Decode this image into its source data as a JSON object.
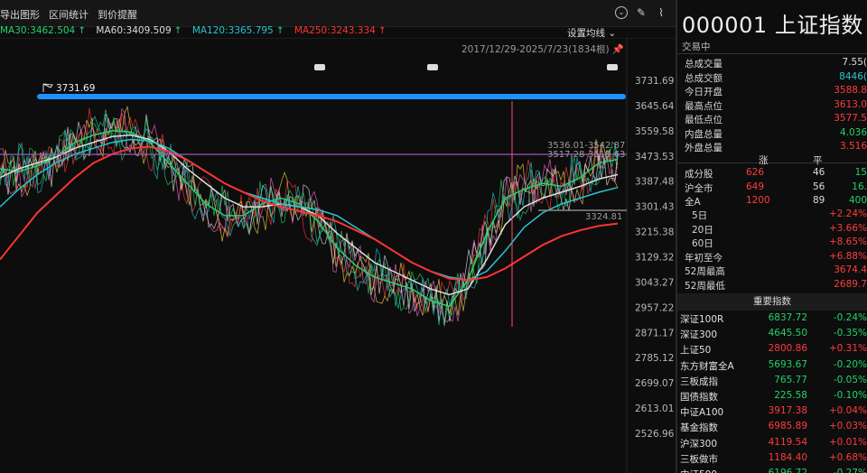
{
  "toolbar": {
    "export_label": "导出图形",
    "interval_label": "区间统计",
    "alert_label": "到价提醒"
  },
  "ma": [
    {
      "label": "MA30:3462.504",
      "color": "#27d36c"
    },
    {
      "label": "MA60:3409.509",
      "color": "#dddddd"
    },
    {
      "label": "MA120:3365.795",
      "color": "#26c6d0"
    },
    {
      "label": "MA250:3243.334",
      "color": "#ff3333"
    }
  ],
  "chart": {
    "settings_label": "设置均线",
    "range_label": "2017/12/29-2025/7/23(1834根)",
    "peak_label": "3731.69",
    "right_label_1": "3536.01-3542.87",
    "right_label_2": "3517.28-3518.63",
    "right_label_3": "3324.81",
    "y_ticks": [
      "3731.69",
      "3645.64",
      "3559.58",
      "3473.53",
      "3387.48",
      "3301.43",
      "3215.38",
      "3129.32",
      "3043.27",
      "2957.22",
      "2871.17",
      "2785.12",
      "2699.07",
      "2613.01",
      "2526.96"
    ],
    "ylim": [
      2526.96,
      3731.69
    ]
  },
  "chart_data": {
    "type": "line",
    "title": "",
    "xlabel": "",
    "ylabel": "",
    "ylim": [
      2526.96,
      3731.69
    ],
    "series": [
      {
        "name": "MA30",
        "color": "#27d36c",
        "values": [
          3430,
          3420,
          3440,
          3470,
          3520,
          3545,
          3560,
          3555,
          3520,
          3450,
          3380,
          3310,
          3270,
          3270,
          3310,
          3330,
          3310,
          3250,
          3160,
          3100,
          3060,
          3040,
          3020,
          2980,
          2960,
          3050,
          3210,
          3330,
          3360,
          3380,
          3370,
          3400,
          3450,
          3462
        ]
      },
      {
        "name": "MA60",
        "color": "#dddddd",
        "values": [
          3400,
          3430,
          3450,
          3470,
          3500,
          3520,
          3540,
          3545,
          3530,
          3490,
          3430,
          3380,
          3330,
          3300,
          3300,
          3310,
          3300,
          3270,
          3210,
          3160,
          3110,
          3080,
          3050,
          3020,
          3000,
          3020,
          3120,
          3240,
          3300,
          3330,
          3350,
          3370,
          3395,
          3410
        ]
      },
      {
        "name": "MA120",
        "color": "#26c6d0",
        "values": [
          3300,
          3360,
          3410,
          3450,
          3480,
          3500,
          3520,
          3530,
          3525,
          3500,
          3460,
          3420,
          3380,
          3350,
          3330,
          3310,
          3300,
          3290,
          3270,
          3230,
          3190,
          3150,
          3110,
          3080,
          3060,
          3050,
          3080,
          3150,
          3230,
          3280,
          3310,
          3330,
          3350,
          3366
        ]
      },
      {
        "name": "MA250",
        "color": "#ff3333",
        "values": [
          3120,
          3200,
          3280,
          3340,
          3400,
          3450,
          3480,
          3500,
          3505,
          3490,
          3460,
          3420,
          3380,
          3350,
          3320,
          3300,
          3285,
          3270,
          3250,
          3220,
          3190,
          3150,
          3110,
          3080,
          3055,
          3050,
          3060,
          3090,
          3130,
          3170,
          3200,
          3220,
          3235,
          3243
        ]
      }
    ]
  },
  "panel": {
    "title": "000001 上证指数",
    "status": "交易中",
    "stats": [
      {
        "label": "总成交量",
        "value": "7.55(",
        "color": "#dddddd"
      },
      {
        "label": "总成交额",
        "value": "8446(",
        "color": "#26c6d0"
      },
      {
        "label": "今日开盘",
        "value": "3588.8",
        "color": "#ff3b3b"
      },
      {
        "label": "最高点位",
        "value": "3613.0",
        "color": "#ff3b3b"
      },
      {
        "label": "最低点位",
        "value": "3577.5",
        "color": "#ff3b3b"
      },
      {
        "label": "内盘总量",
        "value": "4.036",
        "color": "#22d36a"
      },
      {
        "label": "外盘总量",
        "value": "3.516",
        "color": "#ff3b3b"
      }
    ],
    "breadth_header": {
      "up": "涨",
      "flat": "平"
    },
    "breadth": [
      {
        "label": "成分股",
        "up": "626",
        "flat": "46",
        "down": "15"
      },
      {
        "label": "沪全市",
        "up": "649",
        "flat": "56",
        "down": "16."
      },
      {
        "label": "全A",
        "up": "1200",
        "flat": "89",
        "down": "400"
      }
    ],
    "periods": [
      {
        "label": "5日",
        "value": "+2.24%"
      },
      {
        "label": "20日",
        "value": "+3.66%"
      },
      {
        "label": "60日",
        "value": "+8.65%"
      },
      {
        "label": "年初至今",
        "value": "+6.88%"
      },
      {
        "label": "52周最高",
        "value": "3674.4"
      },
      {
        "label": "52周最低",
        "value": "2689.7"
      }
    ],
    "index_header": "重要指数",
    "indices": [
      {
        "name": "深证100R",
        "value": "6837.72",
        "change": "-0.24%",
        "dir": "down"
      },
      {
        "name": "深证300",
        "value": "4645.50",
        "change": "-0.35%",
        "dir": "down"
      },
      {
        "name": "上证50",
        "value": "2800.86",
        "change": "+0.31%",
        "dir": "up"
      },
      {
        "name": "东方财富全A",
        "value": "5693.67",
        "change": "-0.20%",
        "dir": "down"
      },
      {
        "name": "三板成指",
        "value": "765.77",
        "change": "-0.05%",
        "dir": "down"
      },
      {
        "name": "国债指数",
        "value": "225.58",
        "change": "-0.10%",
        "dir": "down"
      },
      {
        "name": "中证A100",
        "value": "3917.38",
        "change": "+0.04%",
        "dir": "up"
      },
      {
        "name": "基金指数",
        "value": "6985.89",
        "change": "+0.03%",
        "dir": "up"
      },
      {
        "name": "沪深300",
        "value": "4119.54",
        "change": "+0.01%",
        "dir": "up"
      },
      {
        "name": "三板做市",
        "value": "1184.40",
        "change": "+0.68%",
        "dir": "up"
      },
      {
        "name": "中证500",
        "value": "6196.72",
        "change": "-0.27%",
        "dir": "down"
      }
    ]
  }
}
